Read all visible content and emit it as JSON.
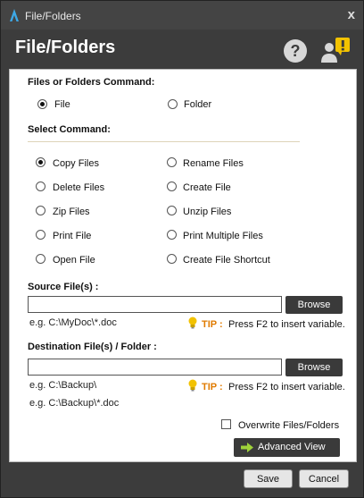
{
  "window": {
    "title": "File/Folders",
    "close_glyph": "x"
  },
  "header": {
    "title": "File/Folders",
    "help_glyph": "?"
  },
  "files_or_folders": {
    "label": "Files or Folders Command:",
    "options": [
      "File",
      "Folder"
    ],
    "selected": "File"
  },
  "select_command": {
    "label": "Select Command:",
    "options": [
      "Copy Files",
      "Rename Files",
      "Delete Files",
      "Create File",
      "Zip Files",
      "Unzip Files",
      "Print File",
      "Print Multiple Files",
      "Open File",
      "Create File Shortcut"
    ],
    "selected": "Copy Files"
  },
  "source": {
    "label": "Source File(s) :",
    "value": "",
    "browse_label": "Browse",
    "example": "e.g. C:\\MyDoc\\*.doc",
    "tip_label": "TIP :",
    "tip_text": "Press F2 to insert variable."
  },
  "destination": {
    "label": "Destination File(s) / Folder :",
    "value": "",
    "browse_label": "Browse",
    "example1": "e.g. C:\\Backup\\",
    "example2": "e.g. C:\\Backup\\*.doc",
    "tip_label": "TIP :",
    "tip_text": "Press F2 to insert variable."
  },
  "overwrite": {
    "label": "Overwrite Files/Folders",
    "checked": false
  },
  "advanced_view_label": "Advanced View",
  "footer": {
    "save_label": "Save",
    "cancel_label": "Cancel"
  },
  "colors": {
    "dark": "#3c3c3c",
    "tip": "#e07b00",
    "bulb": "#f2c200",
    "arrow": "#9fd23a"
  }
}
